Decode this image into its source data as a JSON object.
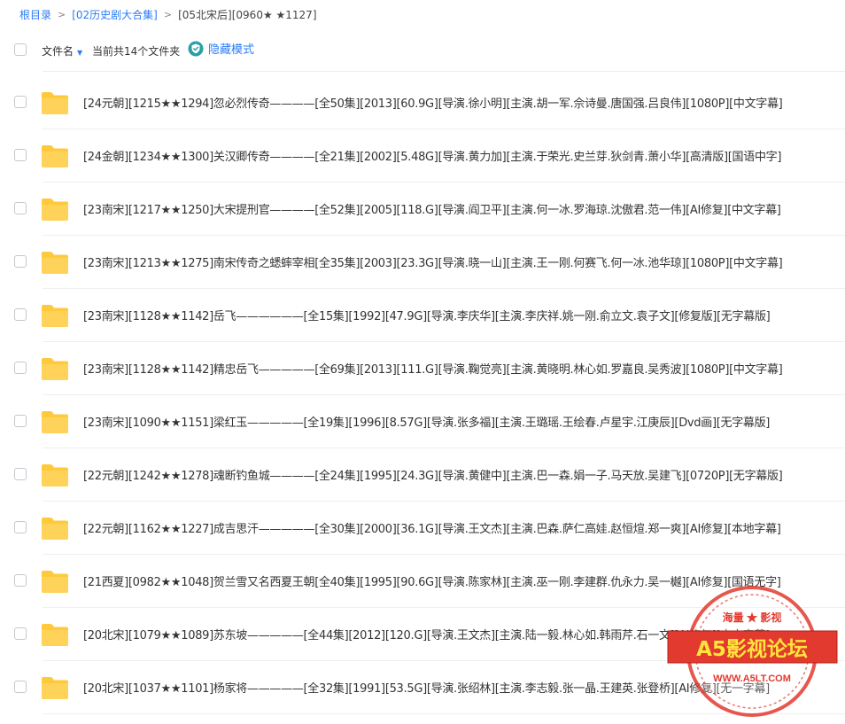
{
  "breadcrumb": {
    "root": "根目录",
    "parent": "[02历史剧大合集]",
    "current": "[05北宋后][0960★ ★1127]"
  },
  "toolbar": {
    "sort_label": "文件名",
    "count_text": "当前共14个文件夹",
    "hide_mode_label": "隐藏模式"
  },
  "colors": {
    "accent": "#2b7cf6",
    "folder": "#ffc93c",
    "hide_mode": "#2b9ea6",
    "watermark_red": "#e23a2e"
  },
  "files": [
    {
      "name": "[24元朝][1215★★1294]忽必烈传奇————[全50集][2013][60.9G][导演.徐小明][主演.胡一军.佘诗曼.唐国强.吕良伟][1080P][中文字幕]"
    },
    {
      "name": "[24金朝][1234★★1300]关汉卿传奇————[全21集][2002][5.48G][导演.黄力加][主演.于荣光.史兰芽.狄剑青.萧小华][高清版][国语中字]"
    },
    {
      "name": "[23南宋][1217★★1250]大宋提刑官————[全52集][2005][118.G][导演.阎卫平][主演.何一冰.罗海琼.沈傲君.范一伟][AI修复][中文字幕]"
    },
    {
      "name": "[23南宋][1213★★1275]南宋传奇之蟋蟀宰相[全35集][2003][23.3G][导演.晓一山][主演.王一刚.何赛飞.何一冰.池华琼][1080P][中文字幕]"
    },
    {
      "name": "[23南宋][1128★★1142]岳飞——————[全15集][1992][47.9G][导演.李庆华][主演.李庆祥.姚一刚.俞立文.袁子文][修复版][无字幕版]"
    },
    {
      "name": "[23南宋][1128★★1142]精忠岳飞—————[全69集][2013][111.G][导演.鞠觉亮][主演.黄晓明.林心如.罗嘉良.吴秀波][1080P][中文字幕]"
    },
    {
      "name": "[23南宋][1090★★1151]梁红玉—————[全19集][1996][8.57G][导演.张多福][主演.王璐瑶.王绘春.卢星宇.江庚辰][Dvd画][无字幕版]"
    },
    {
      "name": "[22元朝][1242★★1278]魂断钓鱼城————[全24集][1995][24.3G][导演.黄健中][主演.巴一森.娟一子.马天放.吴建飞][0720P][无字幕版]"
    },
    {
      "name": "[22元朝][1162★★1227]成吉思汗—————[全30集][2000][36.1G][导演.王文杰][主演.巴森.萨仁高娃.赵恒煊.郑一爽][AI修复][本地字幕]"
    },
    {
      "name": "[21西夏][0982★★1048]贺兰雪又名西夏王朝[全40集][1995][90.6G][导演.陈家林][主演.巫一刚.李建群.仇永力.吴一樾][AI修复][国语无字]"
    },
    {
      "name": "[20北宋][1079★★1089]苏东坡—————[全44集][2012][120.G][导演.王文杰][主演.陆一毅.林心如.韩雨芹.石一文][AI修复][中文字幕]"
    },
    {
      "name": "[20北宋][1037★★1101]杨家将—————[全32集][1991][53.5G][导演.张绍林][主演.李志毅.张一晶.王建英.张登桥][AI修复][无一字幕]"
    }
  ],
  "watermark": {
    "top_text": "海量 ★ 影视",
    "brand": "A5影视论坛",
    "url": "WWW.A5LT.COM"
  }
}
